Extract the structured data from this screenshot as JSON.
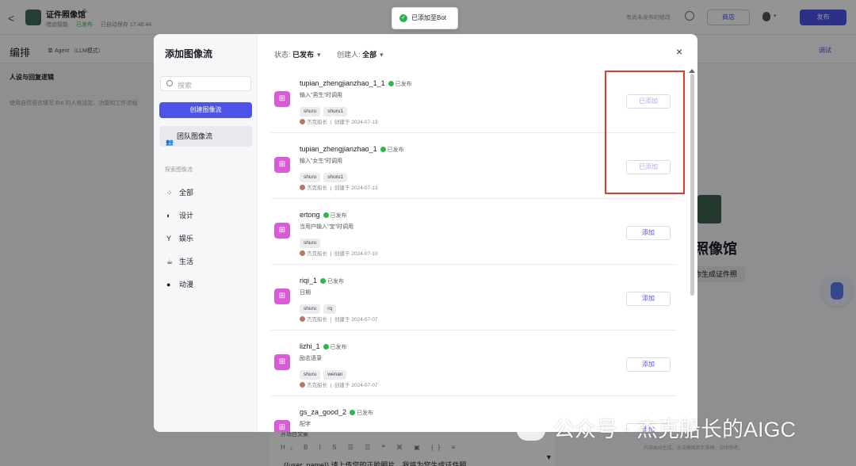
{
  "app": {
    "back": "<",
    "title": "证件照像馆",
    "edit_icon": "✎",
    "meta_team": "暗迹智能",
    "meta_status": "已发布",
    "meta_saved": "已自动保存 17:48:44",
    "unpublished_note": "有尚未发布的修改",
    "store": "商店",
    "publish": "发布"
  },
  "subbar": {
    "title": "编排",
    "agent_mode": "单 Agent （LLM模式）",
    "debug": "调试",
    "section_title": "人设与回复逻辑",
    "section_hint": "使用自然语言填写 Bot 的人格设定、功能和工作流程"
  },
  "preview": {
    "bot_title": "照像馆",
    "bot_chip": "你生成证件照"
  },
  "toast": {
    "text": "已添加至Bot",
    "icon": "check-icon"
  },
  "bottom": {
    "label": "开场白文案",
    "toolbar": "H₂ B I S ☰ ☰ ❝ ⌘ ▣ {} ≡",
    "text": "{{user_name}} 请上传您的正脸照片，我将为您生成证件照",
    "right_hint": "内容由AI生成，无法确保真实准确，仅供参考。"
  },
  "modal": {
    "title": "添加图像流",
    "search_placeholder": "搜索",
    "create_button": "创建图像流",
    "team_item": "团队图像流",
    "explore_label": "探索图像流",
    "categories": [
      {
        "label": "全部",
        "icon": "grid-icon",
        "glyph": "⁘"
      },
      {
        "label": "设计",
        "icon": "palette-icon",
        "glyph": "◐"
      },
      {
        "label": "娱乐",
        "icon": "cocktail-icon",
        "glyph": "Y"
      },
      {
        "label": "生活",
        "icon": "coffee-icon",
        "glyph": "☕"
      },
      {
        "label": "动漫",
        "icon": "bear-icon",
        "glyph": "●"
      }
    ],
    "filter_status_label": "状态:",
    "filter_status_value": "已发布",
    "filter_creator_label": "创建人:",
    "filter_creator_value": "全部",
    "close": "×",
    "items": [
      {
        "name": "tupian_zhengjianzhao_1_1",
        "status": "已发布",
        "desc": "输入\"男生\"时调用",
        "tags": [
          "shuru",
          "shuru1"
        ],
        "author": "杰克船长",
        "created": "创建于 2024-07-13",
        "button": "已添加",
        "added": true
      },
      {
        "name": "tupian_zhengjianzhao_1",
        "status": "已发布",
        "desc": "输入\"女生\"时调用",
        "tags": [
          "shuru",
          "shuru1"
        ],
        "author": "杰克船长",
        "created": "创建于 2024-07-13",
        "button": "已添加",
        "added": true
      },
      {
        "name": "ertong",
        "status": "已发布",
        "desc": "当用户输入\"宝\"时调用",
        "tags": [
          "shuru"
        ],
        "author": "杰克船长",
        "created": "创建于 2024-07-10",
        "button": "添加",
        "added": false
      },
      {
        "name": "riqi_1",
        "status": "已发布",
        "desc": "日期",
        "tags": [
          "shuru",
          "rq"
        ],
        "author": "杰克船长",
        "created": "创建于 2024-07-07",
        "button": "添加",
        "added": false
      },
      {
        "name": "lizhi_1",
        "status": "已发布",
        "desc": "励志语录",
        "tags": [
          "shuru",
          "wenan"
        ],
        "author": "杰克船长",
        "created": "创建于 2024-07-07",
        "button": "添加",
        "added": false
      },
      {
        "name": "gs_za_good_2",
        "status": "已发布",
        "desc": "配字",
        "tags": [],
        "author": "",
        "created": "",
        "button": "添加",
        "added": false
      }
    ]
  },
  "watermark": "公众号 · 杰克船长的AIGC",
  "colors": {
    "accent": "#4d53e8",
    "success": "#2db84d",
    "flow_icon": "#d95cd6",
    "highlight": "#e8382b"
  }
}
